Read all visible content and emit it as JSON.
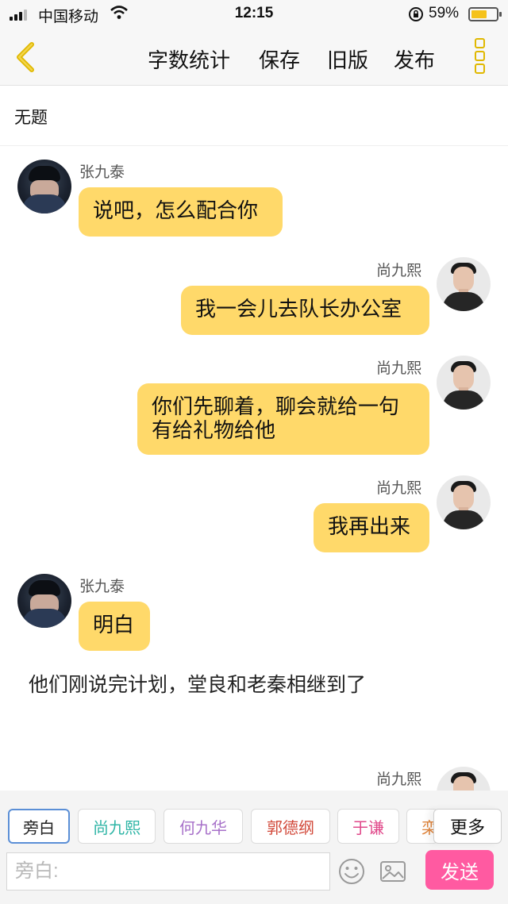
{
  "status_bar": {
    "carrier": "中国移动",
    "time": "12:15",
    "battery": "59%",
    "battery_level": 0.59
  },
  "header": {
    "back_icon": "chevron-left-icon",
    "actions": [
      "字数统计",
      "保存",
      "旧版",
      "发布"
    ],
    "menu_icon": "kebab-menu-icon",
    "accent_color": "#e0b800"
  },
  "doc": {
    "title": "无题"
  },
  "messages": [
    {
      "speaker": "张九泰",
      "side": "left",
      "text": "说吧，怎么配合你"
    },
    {
      "speaker": "尚九熙",
      "side": "right",
      "text": "我一会儿去队长办公室"
    },
    {
      "speaker": "尚九熙",
      "side": "right",
      "text_lines": [
        "你们先聊着，聊会就给一句",
        "有给礼物给他"
      ]
    },
    {
      "speaker": "尚九熙",
      "side": "right",
      "text": "我再出来"
    },
    {
      "speaker": "张九泰",
      "side": "left",
      "text": "明白"
    },
    {
      "speaker": "尚九熙",
      "side": "right",
      "text": ""
    }
  ],
  "narration": "他们刚说完计划，堂良和老秦相继到了",
  "characters": [
    {
      "label": "旁白",
      "color": "#222222",
      "border": "#5b8fd6"
    },
    {
      "label": "尚九熙",
      "color": "#2fb5a6",
      "border": "#dcdcdc"
    },
    {
      "label": "何九华",
      "color": "#a770c9",
      "border": "#dcdcdc"
    },
    {
      "label": "郭德纲",
      "color": "#d24a3b",
      "border": "#dcdcdc"
    },
    {
      "label": "于谦",
      "color": "#e0488a",
      "border": "#dcdcdc"
    },
    {
      "label": "栾",
      "color": "#e0843a",
      "border": "#dcdcdc"
    }
  ],
  "more_label": "更多",
  "composer": {
    "placeholder": "旁白:",
    "value": "",
    "emoji_icon": "smiley-icon",
    "image_icon": "image-icon",
    "send_label": "发送",
    "send_color": "#ff5aa1"
  },
  "bubble_color": "#ffd96a"
}
